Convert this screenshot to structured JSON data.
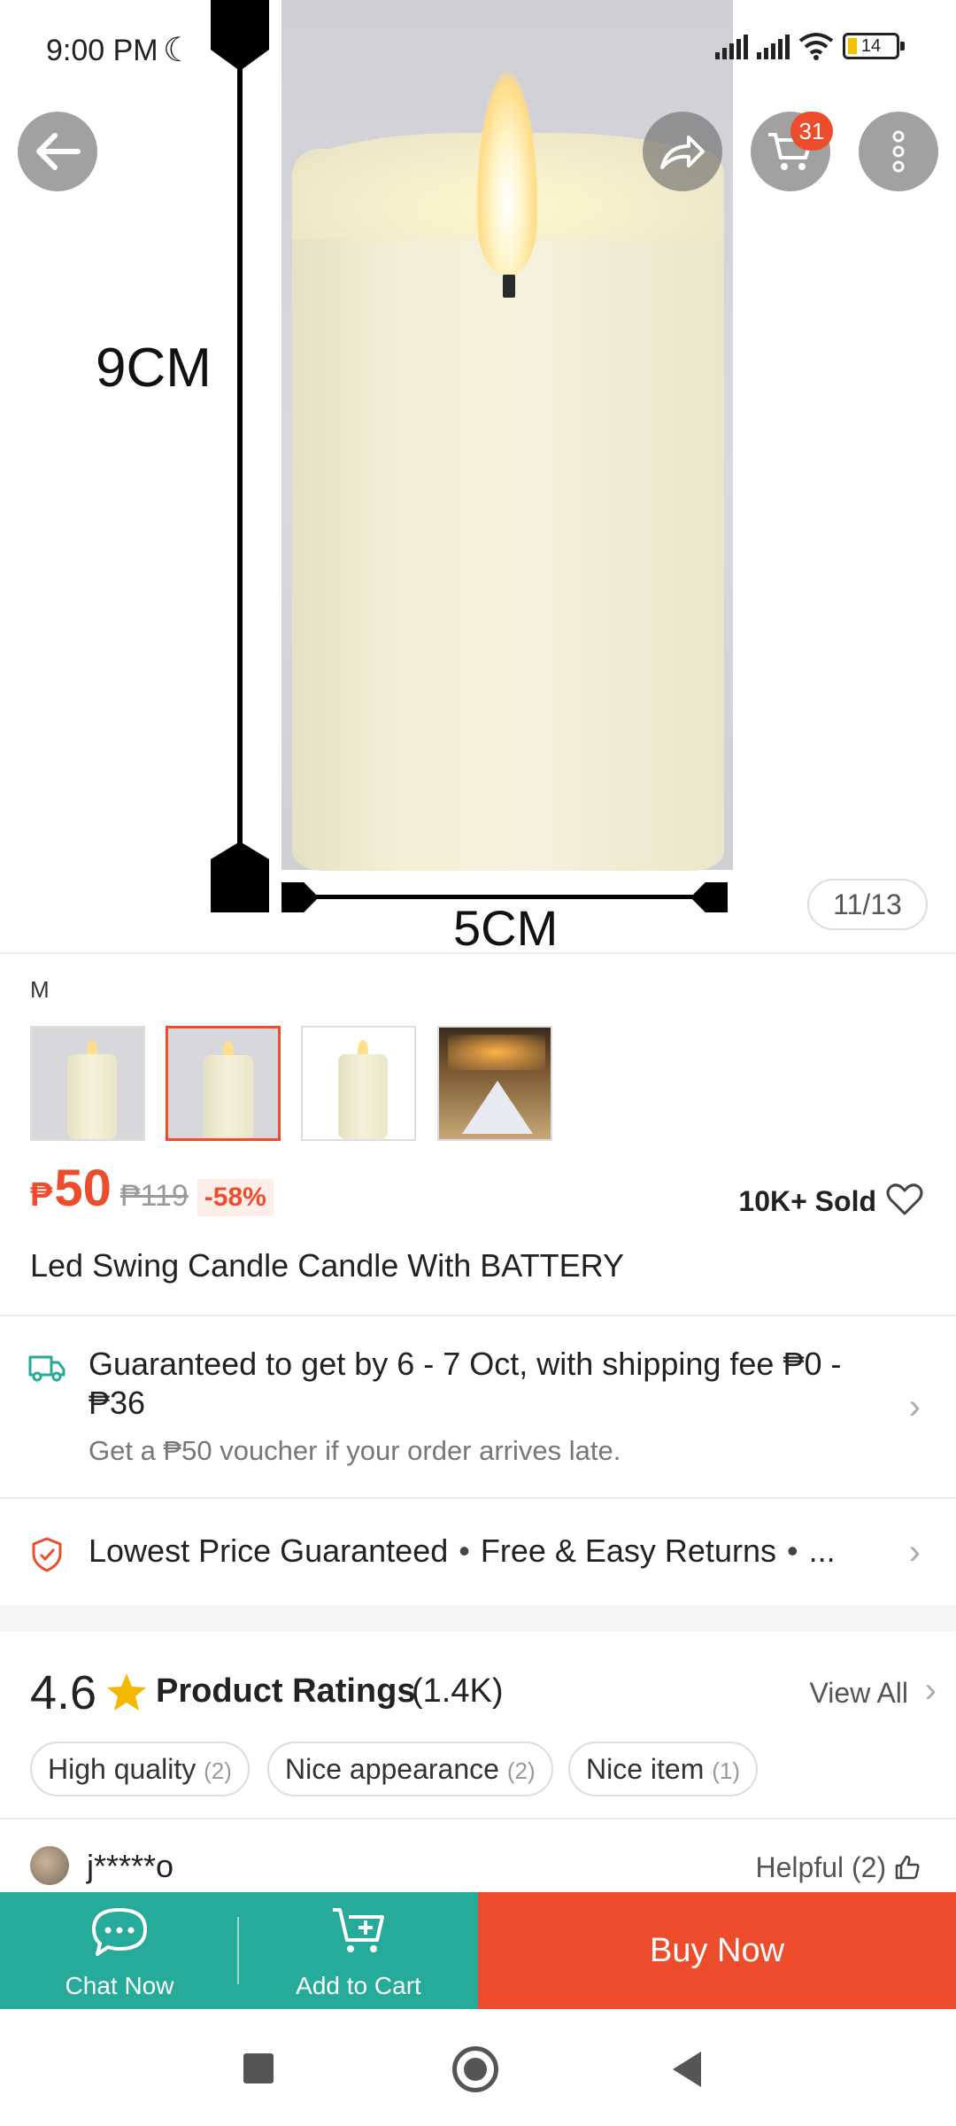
{
  "status_bar": {
    "time": "9:00 PM",
    "battery": "14"
  },
  "header": {
    "cart_count": "31"
  },
  "gallery": {
    "height_label": "9CM",
    "width_label": "5CM",
    "counter": "11/13"
  },
  "variant": {
    "label": "M",
    "thumbnails": [
      "variant-1",
      "variant-2",
      "variant-3",
      "variant-4"
    ],
    "selected_index": 1
  },
  "price": {
    "currency": "₱",
    "current": "50",
    "original": "₱119",
    "discount": "-58%",
    "sold": "10K+ Sold"
  },
  "product": {
    "title": "Led Swing Candle Candle With BATTERY"
  },
  "shipping": {
    "line": "Guaranteed to get by 6 - 7 Oct, with shipping fee ₱0 - ₱36",
    "note": "Get a ₱50 voucher if your order arrives late."
  },
  "guarantees": {
    "item1": "Lowest Price Guaranteed",
    "item2": "Free & Easy Returns",
    "more": "..."
  },
  "ratings": {
    "score": "4.6",
    "label": "Product Ratings",
    "count": "(1.4K)",
    "view_all": "View All",
    "tags": [
      {
        "label": "High quality",
        "count": "(2)"
      },
      {
        "label": "Nice appearance",
        "count": "(2)"
      },
      {
        "label": "Nice item",
        "count": "(1)"
      }
    ],
    "first_review": {
      "user": "j*****o",
      "helpful": "Helpful (2)"
    }
  },
  "bottom_bar": {
    "chat_label": "Chat Now",
    "cart_label": "Add to Cart",
    "buy_label": "Buy Now"
  },
  "colors": {
    "accent": "#ee4d2d",
    "green": "#26aa99"
  }
}
